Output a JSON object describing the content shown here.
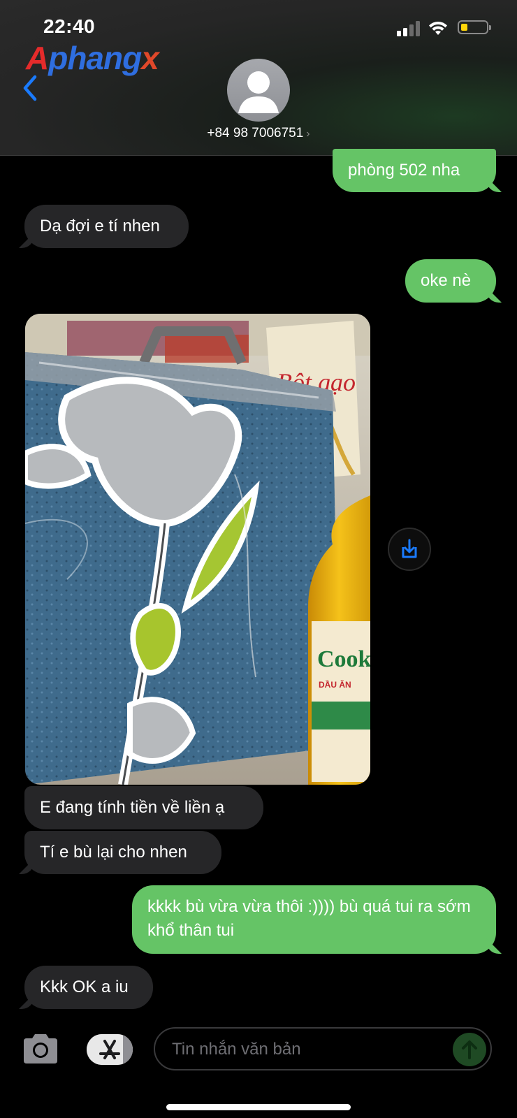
{
  "status_bar": {
    "time": "22:40"
  },
  "watermark": {
    "logo_text": "Aphangx",
    "parts": [
      "A",
      "phang",
      "x"
    ]
  },
  "contact": {
    "phone": "+84 98 7006751",
    "chevron": "›"
  },
  "messages": [
    {
      "direction": "outgoing",
      "text": "phòng 502 nha"
    },
    {
      "direction": "incoming",
      "text": "Dạ đợi e tí nhen"
    },
    {
      "direction": "outgoing",
      "text": "oke nè"
    },
    {
      "direction": "incoming",
      "type": "photo",
      "image_desc": "photo of a packaged floral quilt and a bottle of cooking oil",
      "overlay_texts": [
        "Bột gạo",
        "Cooki",
        "DẦU ĂN"
      ]
    },
    {
      "direction": "incoming",
      "text": "E đang tính tiền về liền ạ"
    },
    {
      "direction": "incoming",
      "text": "Tí e bù lại cho nhen"
    },
    {
      "direction": "outgoing",
      "text": "kkkk bù vừa vừa thôi :)))) bù quá tui ra sớm khổ thân tui"
    },
    {
      "direction": "incoming",
      "text": "Kkk OK a iu"
    }
  ],
  "composer": {
    "placeholder": "Tin nhắn văn bản"
  },
  "colors": {
    "outgoing_bubble": "#65c466",
    "incoming_bubble": "#262628",
    "accent_blue": "#0a84ff",
    "background": "#000000"
  },
  "icons": [
    "back-chevron-icon",
    "contact-avatar-icon",
    "save-photo-icon",
    "camera-icon",
    "app-store-icon",
    "send-arrow-icon",
    "wifi-icon",
    "cellular-signal-icon",
    "battery-icon"
  ]
}
